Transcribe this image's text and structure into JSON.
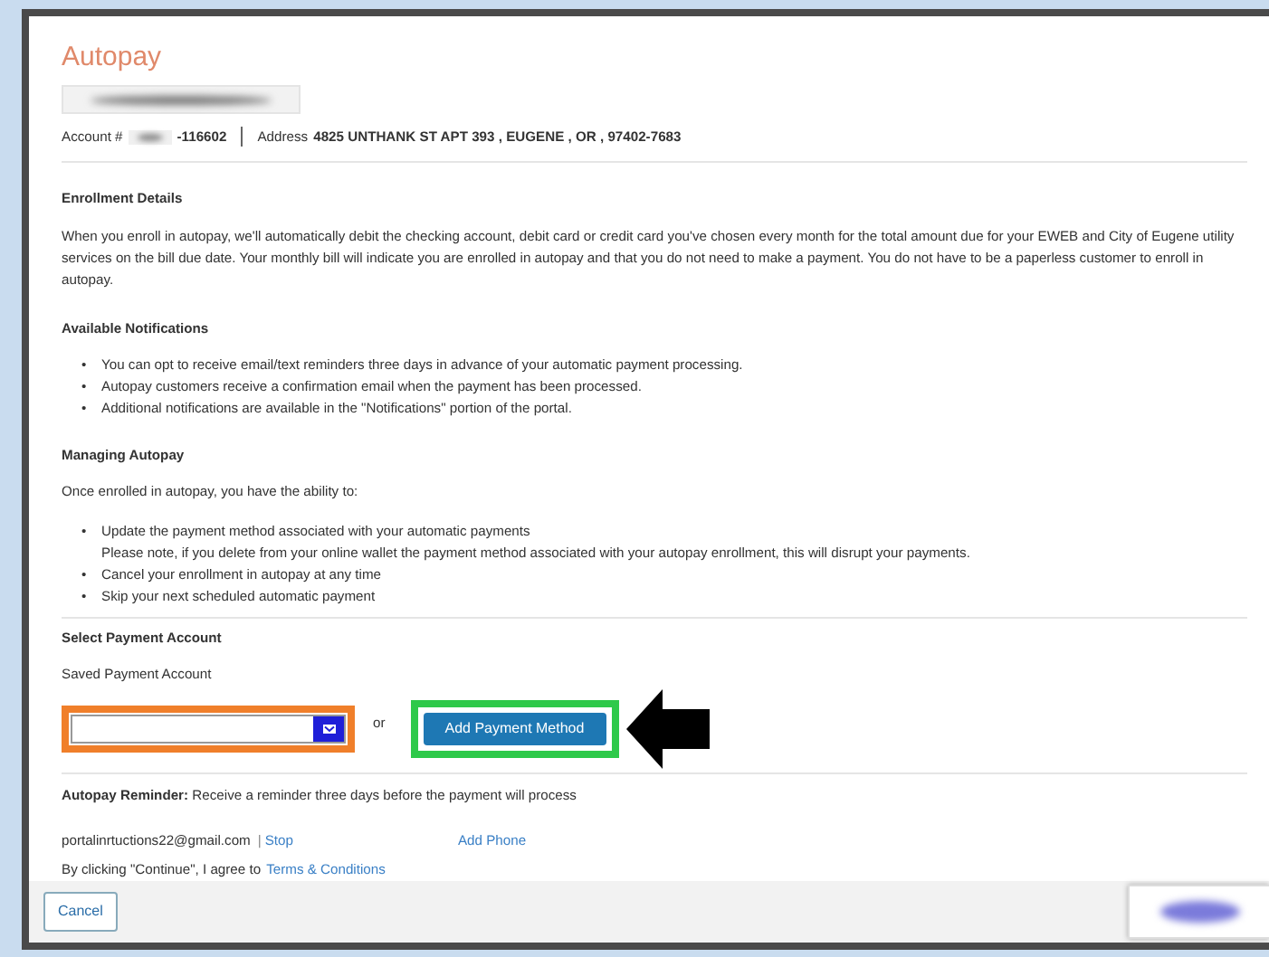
{
  "title": "Autopay",
  "account": {
    "label": "Account #",
    "number_suffix": "-116602",
    "address_label": "Address",
    "address": "4825 UNTHANK ST APT 393 , EUGENE , OR , 97402-7683"
  },
  "sections": [
    {
      "heading": "Enrollment Details",
      "paragraphs": [
        "When you enroll in autopay, we'll automatically debit the checking account, debit card or credit card you've chosen every month for the total amount due for your EWEB and City of Eugene utility services on the bill due date. Your monthly bill will indicate you are enrolled in autopay and that you do not need to make a payment. You do not have to be a paperless customer to enroll in autopay."
      ]
    },
    {
      "heading": "Available Notifications",
      "bullets": [
        {
          "marker": "•",
          "text": "You can opt to receive email/text reminders three days in advance of your automatic payment processing."
        },
        {
          "marker": "•",
          "text": "Autopay customers receive a confirmation email when the payment has been processed."
        },
        {
          "marker": "•",
          "text": "Additional notifications are available in the \"Notifications\" portion of the portal."
        }
      ]
    },
    {
      "heading": "Managing Autopay",
      "paragraphs": [
        "Once enrolled in autopay, you have the ability to:"
      ],
      "bullets": [
        {
          "marker": "•",
          "text": "Update the payment method associated with your automatic payments",
          "note": "Please note, if you delete from your online wallet the payment method associated with your autopay enrollment, this will disrupt your payments."
        },
        {
          "marker": "•",
          "text": "Cancel your enrollment in autopay at any time"
        },
        {
          "marker": "•",
          "text": "Skip your next scheduled automatic payment"
        }
      ]
    }
  ],
  "payment": {
    "heading": "Select Payment Account",
    "field_label": "Saved Payment Account",
    "or": "or",
    "add_button": "Add Payment Method"
  },
  "reminder": {
    "text": "**Autopay Reminder:** Receive a reminder three days before the payment will process",
    "email": "portalinrtuctions22@gmail.com",
    "separator": "|",
    "stop_link": "Stop",
    "phone_link": "Add Phone",
    "agree_text": "By clicking \"Continue\", I agree to",
    "terms_link": "Terms & Conditions"
  },
  "footer": {
    "cancel": "Cancel"
  }
}
